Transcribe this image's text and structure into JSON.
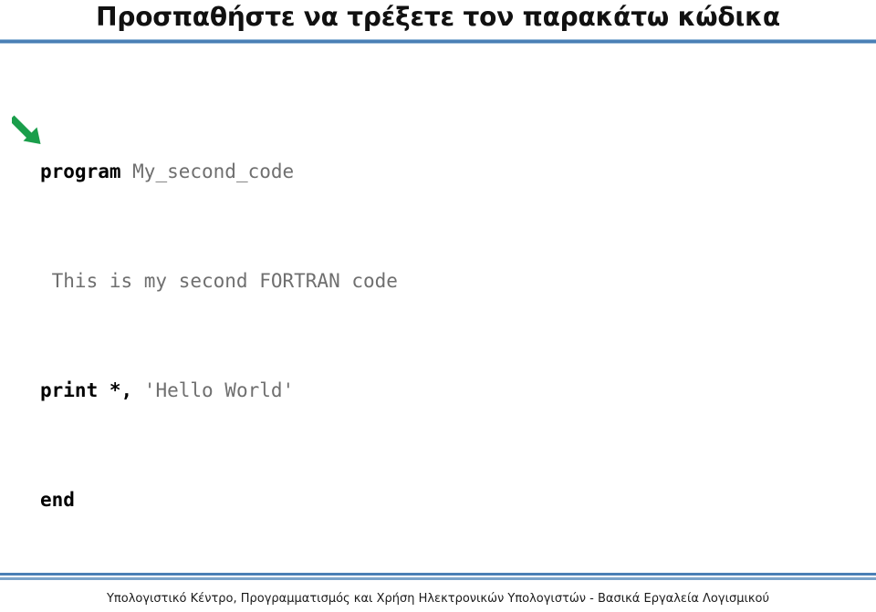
{
  "slide": {
    "title": "Προσπαθήστε να τρέξετε τον παρακάτω κώδικα",
    "background_color": "#ffffff",
    "accent_color": "#4a7fb5"
  },
  "code": {
    "language": "FORTRAN",
    "font": "monospace",
    "keyword_color": "#000000",
    "text_color": "#6f6f6f",
    "lines": [
      {
        "keyword": "program",
        "rest": " My_second_code"
      },
      {
        "keyword": "",
        "rest": " This is my second FORTRAN code"
      },
      {
        "keyword": "print *,",
        "rest": " 'Hello World'"
      },
      {
        "keyword": "end",
        "rest": ""
      }
    ],
    "line1_keyword": "program",
    "line1_rest": " My_second_code",
    "line2_text": " This is my second FORTRAN code",
    "line3_keyword": "print *,",
    "line3_rest": " 'Hello World'",
    "line4_keyword": "end"
  },
  "annotation": {
    "arrow_color": "#1a9e4b",
    "arrow_direction": "down-right",
    "arrow_target": "program My_second_code"
  },
  "footer": {
    "text": "Υπολογιστικό Κέντρο, Προγραμματισμός και Χρήση Ηλεκτρονικών Υπολογιστών - Βασικά Εργαλεία Λογισμικού",
    "rule_color_top": "#4a7fb5",
    "rule_color_bottom": "#7ba3c9"
  }
}
